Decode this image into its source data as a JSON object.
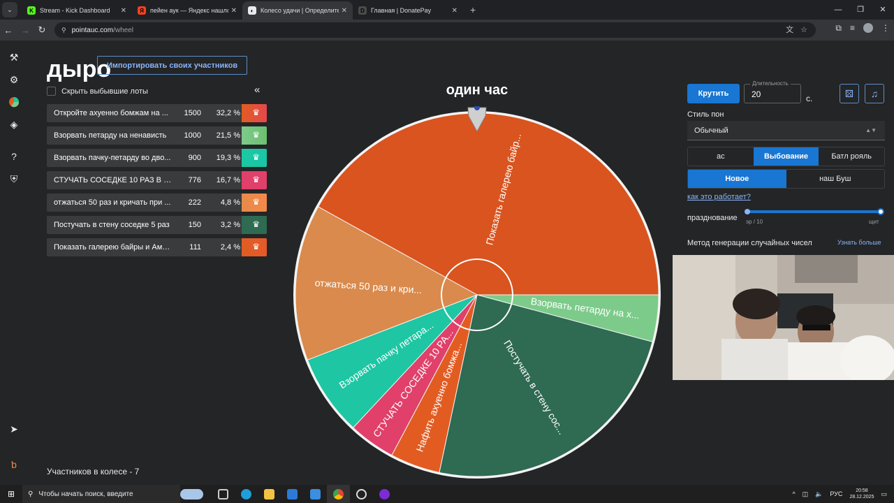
{
  "browser": {
    "tabs": [
      {
        "title": "Stream - Kick Dashboard",
        "fav": "K",
        "fav_color": "#53fc18",
        "active": false
      },
      {
        "title": "пейен аук — Яндекс нашлось",
        "fav": "Я",
        "fav_color": "#fc3f1d",
        "active": false
      },
      {
        "title": "Колесо удачи | Определите п",
        "fav": "◐",
        "fav_color": "#e8eaed",
        "active": true
      },
      {
        "title": "Главная | DonatePay",
        "fav": "D",
        "fav_color": "#4b4b4b",
        "active": false
      }
    ],
    "url_host": "pointauc.com",
    "url_path": "/wheel"
  },
  "app": {
    "logo": "дыро",
    "import_button": "Импортировать своих участников",
    "hide_label": "Скрыть выбывшие лоты",
    "collapse_icon": "«",
    "participants_label": "Участников в колесе - 7",
    "lots": [
      {
        "name": "Откройте ахуенно бомжам на ...",
        "amount": "1500",
        "percent": "32,2 %",
        "color": "#e05d22",
        "grad": "#e5484d"
      },
      {
        "name": "Взорвать петарду на ненависть",
        "amount": "1000",
        "percent": "21,5 %",
        "color": "#7dcb8a",
        "grad": "#6cc070"
      },
      {
        "name": "Взорвать пачку-петарду во дво...",
        "amount": "900",
        "percent": "19,3 %",
        "color": "#1cc7a4",
        "grad": "#19c6a6"
      },
      {
        "name": "СТУЧАТЬ СОСЕДКЕ 10 РАЗ В СТ...",
        "amount": "776",
        "percent": "16,7 %",
        "color": "#e0406a",
        "grad": "#e0406a"
      },
      {
        "name": "отжаться 50 раз и кричать при ...",
        "amount": "222",
        "percent": "4,8 %",
        "color": "#e88a4a",
        "grad": "#f2894a"
      },
      {
        "name": "Постучать в стену соседке 5 раз",
        "amount": "150",
        "percent": "3,2 %",
        "color": "#2e6b52",
        "grad": "#2e6b52"
      },
      {
        "name": "Показать галерею байры и Амы ...",
        "amount": "111",
        "percent": "2,4 %",
        "color": "#e05d22",
        "grad": "#e55a2a"
      }
    ],
    "wheel": {
      "title": "один час",
      "segments": [
        {
          "label": "Показать галерею байр...",
          "color": "#d9541f",
          "start": -151,
          "end": 0
        },
        {
          "label": "Взорвать петарду на х...",
          "color": "#7dcb8a",
          "start": 0,
          "end": 15
        },
        {
          "label": "Постучать в стену сос...",
          "color": "#2f6a53",
          "start": 15,
          "end": 102
        },
        {
          "label": "Нафить ахуенно бомжа...",
          "color": "#e25c22",
          "start": 102,
          "end": 118
        },
        {
          "label": "СТУЧАТЬ СОСЕДКЕ 10 РА...",
          "color": "#e0406a",
          "start": 118,
          "end": 133
        },
        {
          "label": "Взорвать пачку петара...",
          "color": "#1ec6a3",
          "start": 133,
          "end": 159
        },
        {
          "label": "отжаться 50 раз и кри...",
          "color": "#d98a4c",
          "start": 159,
          "end": 209
        }
      ]
    },
    "controls": {
      "spin_button": "Крутить",
      "duration_label": "Длительность",
      "duration_value": "20",
      "duration_unit": "с.",
      "dice_icon": "⚄",
      "music_icon": "♫",
      "style_label": "Стиль пон",
      "style_value": "Обычный",
      "modes": [
        "ас",
        "Выбование",
        "Батл рояль"
      ],
      "active_mode": "Выбование",
      "variants": [
        "Новое",
        "наш Буш"
      ],
      "active_variant": "Новое",
      "how_link": "как это работает?",
      "fest_label": "празднование",
      "slider_left": "эр / 10",
      "slider_right": "щит",
      "rng_label": "Метод генерации случайных чисел",
      "rng_more": "Узнать больше"
    }
  },
  "taskbar": {
    "search_placeholder": "Чтобы начать поиск, введите",
    "lang": "РУС",
    "time": "20:58",
    "date": "28.12.2025"
  }
}
